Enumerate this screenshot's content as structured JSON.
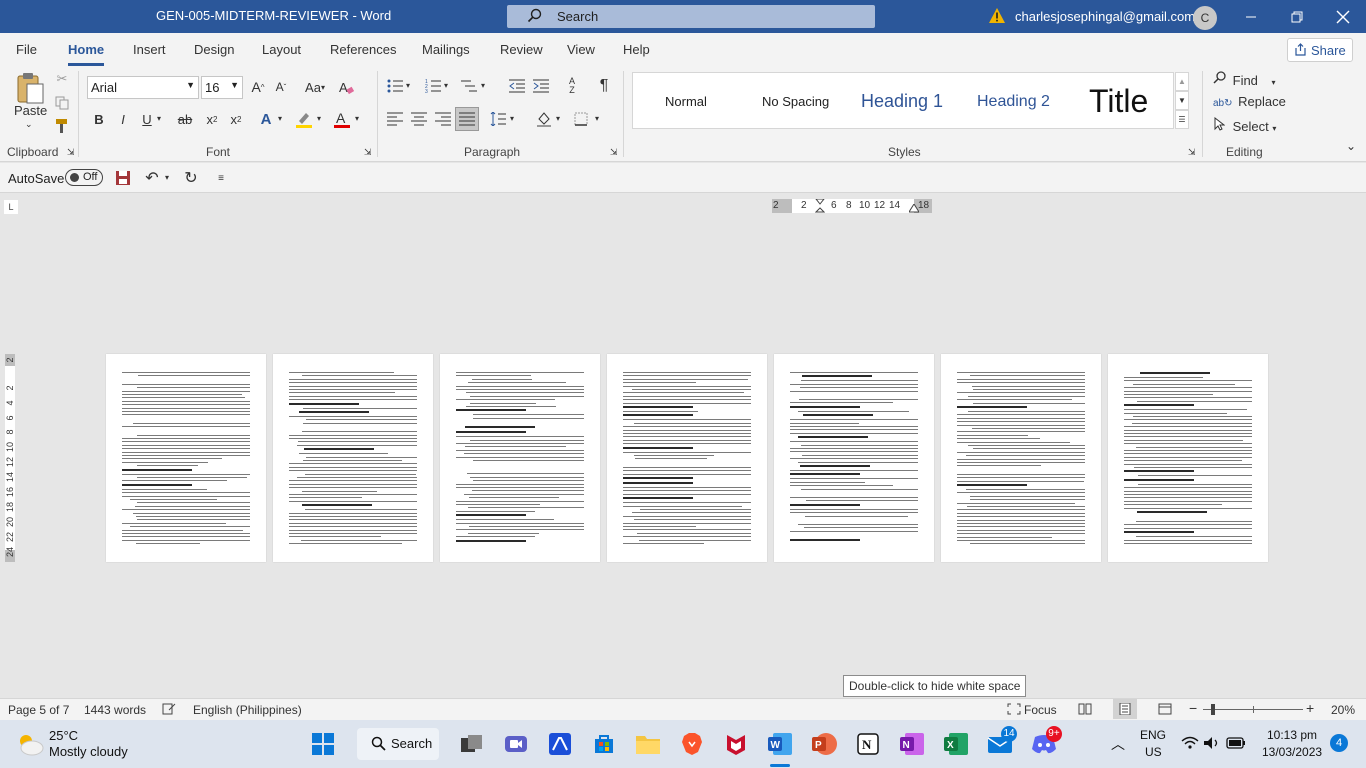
{
  "window": {
    "doc_title": "GEN-005-MIDTERM-REVIEWER  -  Word",
    "search_label": "Search",
    "account_email": "charlesjosephingal@gmail.com",
    "avatar_initial": "C"
  },
  "tabs": [
    "File",
    "Home",
    "Insert",
    "Design",
    "Layout",
    "References",
    "Mailings",
    "Review",
    "View",
    "Help"
  ],
  "active_tab": "Home",
  "share_label": "Share",
  "ribbon": {
    "clipboard": {
      "paste_label": "Paste",
      "group_label": "Clipboard"
    },
    "font": {
      "font_name": "Arial",
      "font_size": "16",
      "group_label": "Font"
    },
    "paragraph": {
      "group_label": "Paragraph"
    },
    "styles": {
      "items": [
        "Normal",
        "No Spacing",
        "Heading 1",
        "Heading 2",
        "Title"
      ],
      "group_label": "Styles"
    },
    "editing": {
      "find": "Find",
      "replace": "Replace",
      "select": "Select",
      "group_label": "Editing"
    }
  },
  "qat": {
    "autosave_label": "AutoSave",
    "autosave_state": "Off"
  },
  "ruler": {
    "marks": [
      "2",
      "2",
      "6",
      "8",
      "10",
      "12",
      "14",
      "18"
    ]
  },
  "vruler": {
    "marks": [
      "2",
      "2",
      "4",
      "6",
      "8",
      "10",
      "12",
      "14",
      "16",
      "18",
      "20",
      "22",
      "24"
    ]
  },
  "tooltip": "Double-click to hide white space",
  "status": {
    "page": "Page 5 of 7",
    "words": "1443 words",
    "language": "English (Philippines)",
    "focus": "Focus",
    "zoom": "20%"
  },
  "taskbar": {
    "temp": "25°C",
    "weather": "Mostly cloudy",
    "search": "Search",
    "lang_top": "ENG",
    "lang_bottom": "US",
    "time": "10:13 pm",
    "date": "13/03/2023",
    "notif_count": "4",
    "badge_mail": "14",
    "badge_discord": "9+"
  },
  "colors": {
    "accent": "#2b579a",
    "title_bar": "#2b579a"
  }
}
